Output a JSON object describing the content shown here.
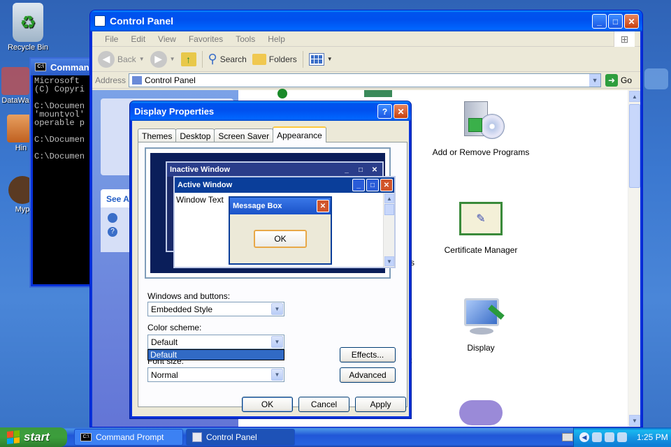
{
  "desktop": {
    "icons": [
      {
        "label": "Recycle Bin"
      },
      {
        "label": "DataWa"
      },
      {
        "label": "Hin"
      },
      {
        "label": "Myp"
      }
    ]
  },
  "control_panel": {
    "title": "Control Panel",
    "menu": [
      "File",
      "Edit",
      "View",
      "Favorites",
      "Tools",
      "Help"
    ],
    "toolbar": {
      "back": "Back",
      "search": "Search",
      "folders": "Folders"
    },
    "address_label": "Address",
    "address_value": "Control Panel",
    "go_label": "Go",
    "left_pane": {
      "see_also": "See A"
    },
    "items": [
      {
        "label": "Add or Remove Programs"
      },
      {
        "label": "Certificate Manager"
      },
      {
        "label": "Display"
      }
    ],
    "partial_text": [
      "s",
      ":"
    ]
  },
  "command_prompt": {
    "title": "Command",
    "lines": [
      "Microsoft",
      "(C) Copyri",
      "",
      "C:\\Documen",
      "'mountvol'",
      "operable p",
      "",
      "C:\\Documen",
      "",
      "C:\\Documen"
    ]
  },
  "display_properties": {
    "title": "Display Properties",
    "tabs": [
      "Themes",
      "Desktop",
      "Screen Saver",
      "Appearance"
    ],
    "active_tab": "Appearance",
    "preview": {
      "inactive_title": "Inactive Window",
      "active_title": "Active Window",
      "window_text": "Window Text",
      "msgbox_title": "Message Box",
      "ok": "OK"
    },
    "windows_buttons_label": "Windows and buttons:",
    "windows_buttons_value": "Embedded Style",
    "color_scheme_label": "Color scheme:",
    "color_scheme_value": "Default",
    "color_scheme_option": "Default",
    "font_size_label": "Font size:",
    "font_size_value": "Normal",
    "effects": "Effects...",
    "advanced": "Advanced",
    "ok": "OK",
    "cancel": "Cancel",
    "apply": "Apply"
  },
  "taskbar": {
    "start": "start",
    "tasks": [
      "Command Prompt",
      "Control Panel"
    ],
    "clock": "1:25 PM"
  }
}
